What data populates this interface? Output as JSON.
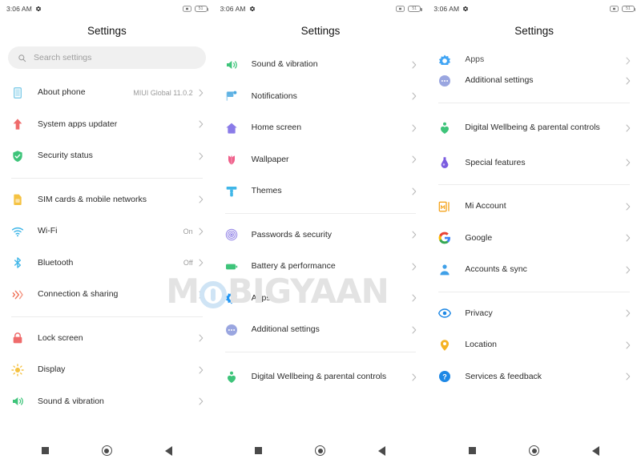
{
  "status_bar": {
    "time": "3:06 AM",
    "gear_icon": "gear-icon",
    "mute_icon": "mute-icon",
    "battery_level": "51"
  },
  "title": "Settings",
  "search": {
    "placeholder": "Search settings",
    "icon": "search-icon"
  },
  "nav_bar": {
    "recents": "recents-square-icon",
    "home": "home-circle-icon",
    "back": "back-triangle-icon"
  },
  "watermark": {
    "before": "M",
    "circle": "O",
    "after": "BIGYAAN"
  },
  "panels": [
    {
      "has_search": true,
      "groups": [
        {
          "items": [
            {
              "label": "About phone",
              "value": "MIUI Global 11.0.2",
              "icon": "phone-icon",
              "color": "#7ecbe8"
            },
            {
              "label": "System apps updater",
              "value": "",
              "icon": "up-arrow-icon",
              "color": "#ef6b6b"
            },
            {
              "label": "Security status",
              "value": "",
              "icon": "shield-check-icon",
              "color": "#3ec47a"
            }
          ]
        },
        {
          "items": [
            {
              "label": "SIM cards & mobile networks",
              "value": "",
              "icon": "sim-card-icon",
              "color": "#f5c242"
            },
            {
              "label": "Wi-Fi",
              "value": "On",
              "icon": "wifi-icon",
              "color": "#3fb6e8"
            },
            {
              "label": "Bluetooth",
              "value": "Off",
              "icon": "bluetooth-icon",
              "color": "#3fb6e8"
            },
            {
              "label": "Connection & sharing",
              "value": "",
              "icon": "connection-sharing-icon",
              "color": "#f0735a"
            }
          ]
        },
        {
          "items": [
            {
              "label": "Lock screen",
              "value": "",
              "icon": "lock-icon",
              "color": "#ef6b6b"
            },
            {
              "label": "Display",
              "value": "",
              "icon": "brightness-sun-icon",
              "color": "#f5c242"
            },
            {
              "label": "Sound & vibration",
              "value": "",
              "icon": "speaker-icon",
              "color": "#3ec47a"
            }
          ]
        }
      ]
    },
    {
      "has_search": false,
      "groups": [
        {
          "items": [
            {
              "label": "Sound & vibration",
              "value": "",
              "icon": "speaker-icon",
              "color": "#3ec47a"
            },
            {
              "label": "Notifications",
              "value": "",
              "icon": "notifications-icon",
              "color": "#4aa8e0"
            },
            {
              "label": "Home screen",
              "value": "",
              "icon": "home-icon",
              "color": "#8a7be8"
            },
            {
              "label": "Wallpaper",
              "value": "",
              "icon": "wallpaper-flower-icon",
              "color": "#ef5f8a"
            },
            {
              "label": "Themes",
              "value": "",
              "icon": "themes-brush-icon",
              "color": "#3fb6e8"
            }
          ]
        },
        {
          "items": [
            {
              "label": "Passwords & security",
              "value": "",
              "icon": "fingerprint-icon",
              "color": "#9a8ce8"
            },
            {
              "label": "Battery & performance",
              "value": "",
              "icon": "battery-icon",
              "color": "#3ec47a"
            },
            {
              "label": "Apps",
              "value": "",
              "icon": "apps-gear-icon",
              "color": "#2196f3"
            },
            {
              "label": "Additional settings",
              "value": "",
              "icon": "additional-settings-icon",
              "color": "#9aa6e0"
            }
          ]
        },
        {
          "items": [
            {
              "label": "Digital Wellbeing & parental controls",
              "value": "",
              "icon": "wellbeing-icon",
              "color": "#3ec47a",
              "tall": true
            }
          ]
        }
      ]
    },
    {
      "has_search": false,
      "groups": [
        {
          "items": [
            {
              "label": "Apps",
              "value": "",
              "icon": "apps-gear-icon",
              "color": "#2196f3",
              "clipped": true
            },
            {
              "label": "Additional settings",
              "value": "",
              "icon": "additional-settings-icon",
              "color": "#9aa6e0"
            }
          ]
        },
        {
          "items": [
            {
              "label": "Digital Wellbeing & parental controls",
              "value": "",
              "icon": "wellbeing-icon",
              "color": "#3ec47a",
              "tall": true
            },
            {
              "label": "Special features",
              "value": "",
              "icon": "special-features-icon",
              "color": "#7b5ce0"
            }
          ]
        },
        {
          "items": [
            {
              "label": "Mi Account",
              "value": "",
              "icon": "mi-account-icon",
              "color": "#f5a623"
            },
            {
              "label": "Google",
              "value": "",
              "icon": "google-icon",
              "color": "#4285f4"
            },
            {
              "label": "Accounts & sync",
              "value": "",
              "icon": "accounts-sync-icon",
              "color": "#3fa0e8"
            }
          ]
        },
        {
          "items": [
            {
              "label": "Privacy",
              "value": "",
              "icon": "privacy-eye-icon",
              "color": "#1e88e5"
            },
            {
              "label": "Location",
              "value": "",
              "icon": "location-pin-icon",
              "color": "#f5b324"
            },
            {
              "label": "Services & feedback",
              "value": "",
              "icon": "services-feedback-icon",
              "color": "#1e88e5"
            }
          ]
        }
      ]
    }
  ]
}
